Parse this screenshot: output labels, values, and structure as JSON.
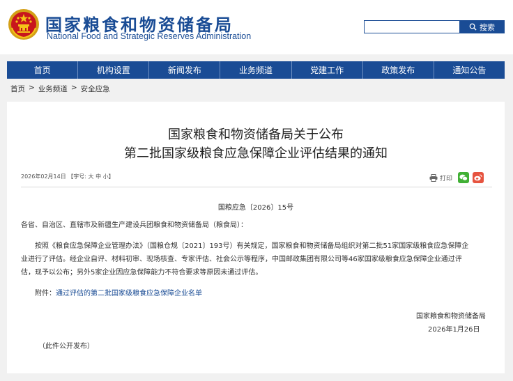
{
  "header": {
    "title_cn": "国家粮食和物资储备局",
    "title_en": "National Food and Strategic Reserves Administration",
    "emblem_icon": "national-emblem-icon"
  },
  "search": {
    "value": "",
    "button_label": "搜索",
    "icon": "search-icon"
  },
  "nav": {
    "items": [
      {
        "label": "首页"
      },
      {
        "label": "机构设置"
      },
      {
        "label": "新闻发布"
      },
      {
        "label": "业务频道"
      },
      {
        "label": "党建工作"
      },
      {
        "label": "政策发布"
      },
      {
        "label": "通知公告"
      }
    ]
  },
  "breadcrumb": {
    "items": [
      "首页",
      "业务频道",
      "安全应急"
    ],
    "separator": ">"
  },
  "article": {
    "title_line1": "国家粮食和物资储备局关于公布",
    "title_line2": "第二批国家级粮食应急保障企业评估结果的通知",
    "date": "2026年02月14日",
    "font_size_label": "【字号:",
    "font_sizes": [
      "大",
      "中",
      "小"
    ],
    "font_size_end": "】",
    "print_label": "打印",
    "share_icons": [
      "wechat-icon",
      "weibo-icon"
    ],
    "doc_number": "国粮应急〔2026〕15号",
    "salutation": "各省、自治区、直辖市及新疆生产建设兵团粮食和物资储备局（粮食局）：",
    "body_line1": "按照《粮食应急保障企业管理办法》（国粮仓规〔2021〕193号）有关规定，国家粮食和物资储备局组织对第二批51家国家级粮食应急保障企",
    "body_line2": "业进行了评估。经企业自评、材料初审、现场核查、专家评估、社会公示等程序，中国邮政集团有限公司等46家国家级粮食应急保障企业通过评",
    "body_line3": "估，现予以公布；另外5家企业因应急保障能力不符合要求等原因未通过评估。",
    "attachment_label": "附件：",
    "attachment_link": "通过评估的第二批国家级粮食应急保障企业名单",
    "signature": "国家粮食和物资储备局",
    "sign_date": "2026年1月26日",
    "footer_note": "（此件公开发布）"
  },
  "colors": {
    "brand_blue": "#1a4c95",
    "page_bg": "#f1f1f1",
    "wechat_green": "#41b035",
    "weibo_red": "#e6533f"
  }
}
